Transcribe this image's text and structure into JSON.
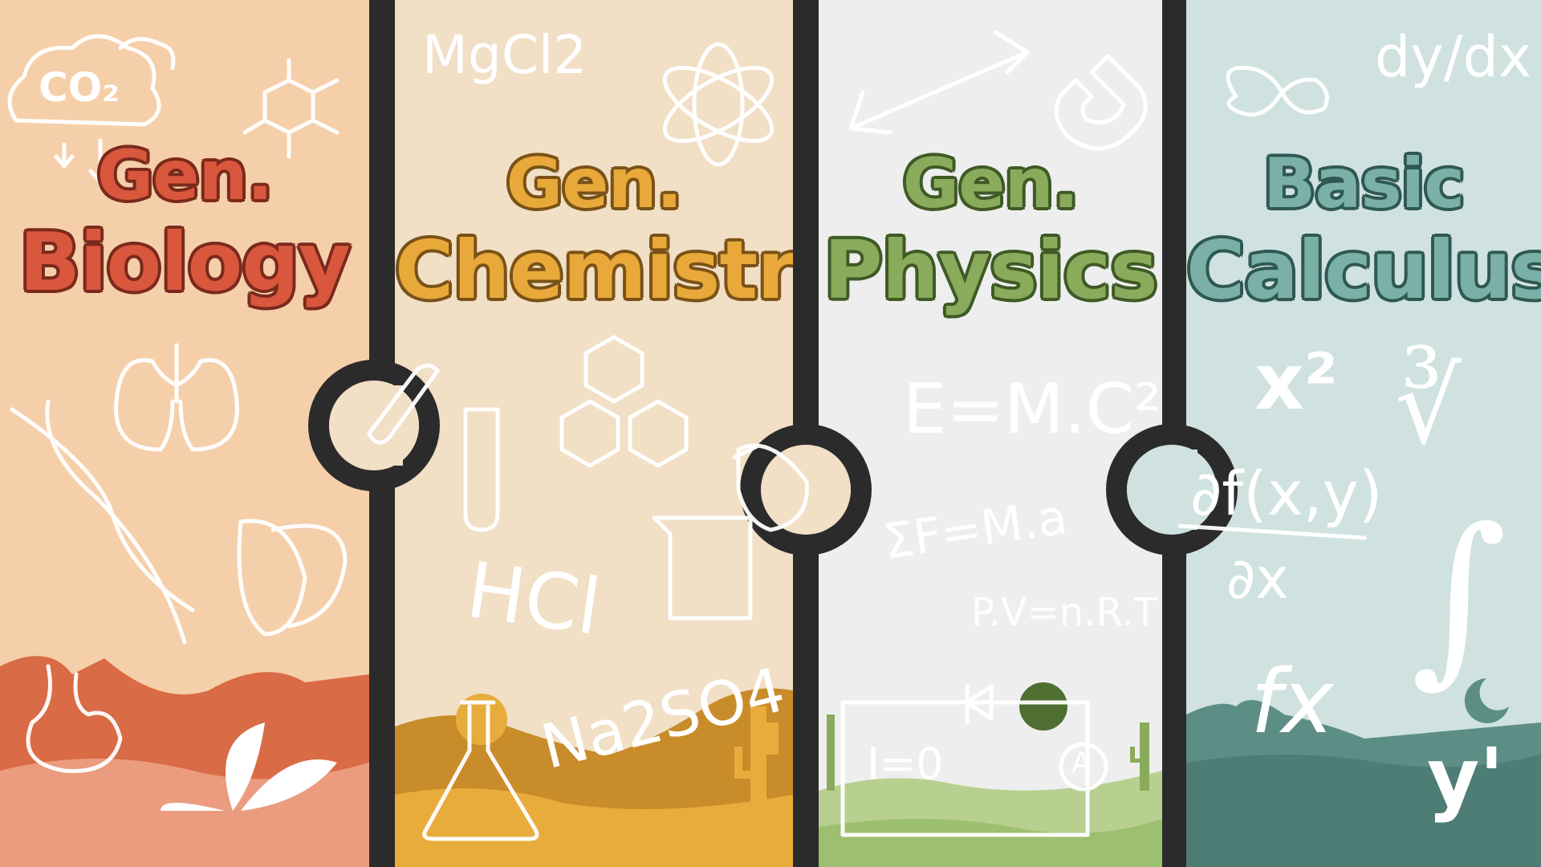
{
  "panels": [
    {
      "id": "biology",
      "title_line1": "Gen.",
      "title_line2": "Biology",
      "title_color": "#d9573d",
      "title_outline": "#7a2a1c",
      "background": "#f5cfa9",
      "doodles": {
        "co2": "CO₂"
      },
      "icons": [
        "cloud-icon",
        "molecule-icon",
        "lungs-icon",
        "dna-icon",
        "leaf-icon",
        "stomach-icon",
        "plant-icon"
      ]
    },
    {
      "id": "chemistry",
      "title_line1": "Gen.",
      "title_line2": "Chemistry",
      "title_color": "#e8a93a",
      "title_outline": "#7a5217",
      "background": "#f1dfc6",
      "doodles": {
        "mgcl2": "MgCl2",
        "hcl": "HCl",
        "na2so4": "Na2SO4"
      },
      "icons": [
        "atom-icon",
        "test-tube-icon",
        "hexagon-icon",
        "flask-icon",
        "beaker-icon",
        "cactus-icon"
      ]
    },
    {
      "id": "physics",
      "title_line1": "Gen.",
      "title_line2": "Physics",
      "title_color": "#8aab5c",
      "title_outline": "#3f5a25",
      "background": "#eeeeee",
      "doodles": {
        "emc": "E=M.C²",
        "sfma": "ΣF=M.a",
        "pvnrt": "P.V=n.R.T",
        "i0": "I=0",
        "ammeter": "A"
      },
      "icons": [
        "arrow-icon",
        "magnet-icon",
        "circuit-icon",
        "cactus-icon"
      ]
    },
    {
      "id": "calculus",
      "title_line1": "Basic",
      "title_line2": "Calculus",
      "title_color": "#7bb0a8",
      "title_outline": "#2f5853",
      "background": "#cfe2df",
      "doodles": {
        "dydx": "dy/dx",
        "x2": "x²",
        "root": "∛",
        "partial_num": "∂f(x,y)",
        "partial_den": "∂x",
        "integral": "∫",
        "fx": "fx",
        "yprime": "y'"
      },
      "icons": [
        "infinity-icon",
        "moon-icon"
      ]
    }
  ]
}
